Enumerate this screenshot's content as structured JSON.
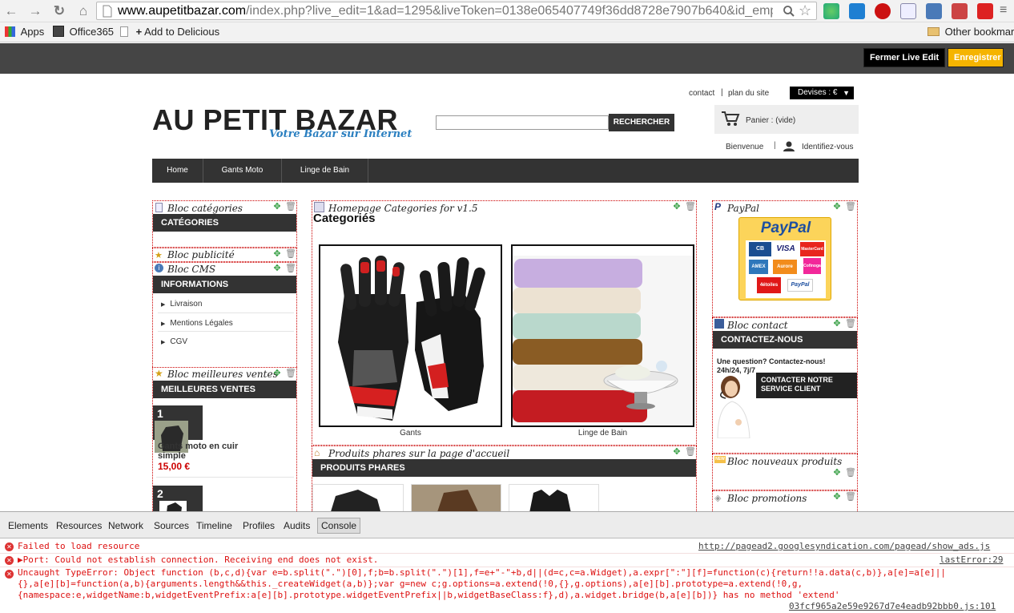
{
  "browser": {
    "url_host": "www.aupetitbazar.com",
    "url_rest": "/index.php?live_edit=1&ad=1295&liveToken=0138e065407749f36dd8728e7907b640&id_emp",
    "bookmarks": [
      "Apps",
      "Office365",
      "Add to Delicious"
    ],
    "other_bookmarks": "Other bookmarks"
  },
  "admin": {
    "close_live_edit": "Fermer Live Edit",
    "save": "Enregistrer"
  },
  "header": {
    "contact": "contact",
    "sep": "|",
    "sitemap": "plan du site",
    "currency": "Devises : €",
    "logo": "AU PETIT BAZAR",
    "tagline": "Votre Bazar sur Internet",
    "search_button": "RECHERCHER",
    "cart": "Panier : (vide)",
    "welcome": "Bienvenue",
    "login": "Identifiez-vous"
  },
  "menu": [
    "Home",
    "Gants Moto",
    "Linge de Bain"
  ],
  "left": {
    "bloc_categories": "Bloc catégories",
    "categories_head": "CATÉGORIES",
    "bloc_pub": "Bloc publicité",
    "bloc_cms": "Bloc CMS",
    "info_head": "INFORMATIONS",
    "info_items": [
      "Livraison",
      "Mentions Légales",
      "CGV"
    ],
    "bloc_best": "Bloc meilleures ventes",
    "best_head": "MEILLEURES VENTES",
    "best1_rank": "1",
    "best1_name": "Gants moto en cuir simple",
    "best1_price": "15,00 €",
    "best2_rank": "2"
  },
  "center": {
    "bloc_home_cat": "Homepage Categories for v1.5",
    "cat_heading": "Categoriés",
    "cat1": "Gants",
    "cat2": "Linge de Bain",
    "bloc_featured": "Produits phares sur la page d'accueil",
    "featured_head": "PRODUITS PHARES"
  },
  "right": {
    "paypal": "PayPal",
    "paypal_logo": "PayPal",
    "cards": [
      "CB",
      "VISA",
      "MasterCard",
      "AMEX",
      "Aurore",
      "Cofinoga",
      "4étoiles",
      "PayPal"
    ],
    "bloc_contact": "Bloc contact",
    "contact_head": "CONTACTEZ-NOUS",
    "contact_q": "Une question? Contactez-nous!",
    "contact_hours": "24h/24, 7j/7",
    "contact_btn": "CONTACTER NOTRE SERVICE CLIENT",
    "bloc_new": "Bloc nouveaux produits",
    "bloc_promo": "Bloc promotions"
  },
  "devtools": {
    "tabs": [
      "Elements",
      "Resources",
      "Network",
      "Sources",
      "Timeline",
      "Profiles",
      "Audits",
      "Console"
    ],
    "err1": "Failed to load resource",
    "err1_src": "http://pagead2.googlesyndication.com/pagead/show_ads.js",
    "err2": "▶Port: Could not establish connection. Receiving end does not exist.",
    "err2_src": "lastError:29",
    "err3a": "Uncaught TypeError: Object function (b,c,d){var e=b.split(\".\")[0],f;b=b.split(\".\")[1],f=e+\"-\"+b,d||(d=c,c=a.Widget),a.expr[\":\"][f]=function(c){return!!a.data(c,b)},a[e]=a[e]||",
    "err3b": "{},a[e][b]=function(a,b){arguments.length&&this._createWidget(a,b)};var g=new c;g.options=a.extend(!0,{},g.options),a[e][b].prototype=a.extend(!0,g,",
    "err3c": "{namespace:e,widgetName:b,widgetEventPrefix:a[e][b].prototype.widgetEventPrefix||b,widgetBaseClass:f},d),a.widget.bridge(b,a[e][b])} has no method 'extend'",
    "err3_src": "03fcf965a2e59e9267d7e4eadb92bbb0.js:101"
  }
}
